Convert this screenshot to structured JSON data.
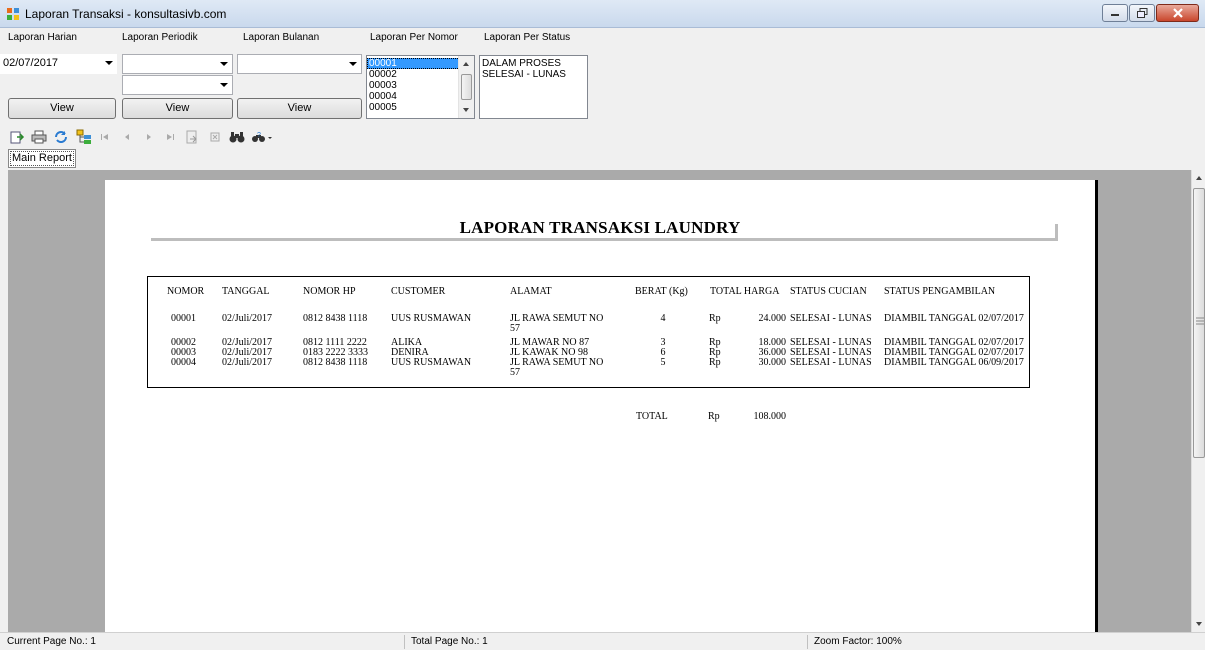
{
  "window": {
    "title": "Laporan Transaksi - konsultasivb.com"
  },
  "filters": {
    "harian": {
      "label": "Laporan Harian",
      "value": "02/07/2017",
      "button": "View"
    },
    "periodik": {
      "label": "Laporan Periodik",
      "value1": "",
      "value2": "",
      "button": "View"
    },
    "bulanan": {
      "label": "Laporan Bulanan",
      "value": "",
      "button": "View"
    },
    "nomor": {
      "label": "Laporan Per Nomor",
      "items": [
        "00001",
        "00002",
        "00003",
        "00004",
        "00005"
      ],
      "selected": "00001"
    },
    "status": {
      "label": "Laporan Per Status",
      "items": [
        "DALAM PROSES",
        "SELESAI - LUNAS"
      ]
    }
  },
  "tabs": {
    "main": "Main Report"
  },
  "report": {
    "title": "LAPORAN TRANSAKSI LAUNDRY",
    "headers": [
      "NOMOR",
      "TANGGAL",
      "NOMOR HP",
      "CUSTOMER",
      "ALAMAT",
      "BERAT (Kg)",
      "TOTAL HARGA",
      "STATUS CUCIAN",
      "STATUS PENGAMBILAN"
    ],
    "rows": [
      {
        "nomor": "00001",
        "tanggal": "02/Juli/2017",
        "hp": "0812 8438 1118",
        "customer": "UUS RUSMAWAN",
        "alamat1": "JL RAWA SEMUT NO",
        "alamat2": "57",
        "berat": "4",
        "rp": "Rp",
        "harga": "24.000",
        "status": "SELESAI - LUNAS",
        "ambil": "DIAMBIL TANGGAL 02/07/2017"
      },
      {
        "nomor": "00002",
        "tanggal": "02/Juli/2017",
        "hp": "0812 1111 2222",
        "customer": "ALIKA",
        "alamat1": "JL MAWAR NO 87",
        "alamat2": "",
        "berat": "3",
        "rp": "Rp",
        "harga": "18.000",
        "status": "SELESAI - LUNAS",
        "ambil": "DIAMBIL TANGGAL 02/07/2017"
      },
      {
        "nomor": "00003",
        "tanggal": "02/Juli/2017",
        "hp": "0183 2222 3333",
        "customer": "DENIRA",
        "alamat1": "JL KAWAK NO 98",
        "alamat2": "",
        "berat": "6",
        "rp": "Rp",
        "harga": "36.000",
        "status": "SELESAI - LUNAS",
        "ambil": "DIAMBIL TANGGAL 02/07/2017"
      },
      {
        "nomor": "00004",
        "tanggal": "02/Juli/2017",
        "hp": "0812 8438 1118",
        "customer": "UUS RUSMAWAN",
        "alamat1": "JL RAWA SEMUT NO",
        "alamat2": "57",
        "berat": "5",
        "rp": "Rp",
        "harga": "30.000",
        "status": "SELESAI - LUNAS",
        "ambil": "DIAMBIL TANGGAL 06/09/2017"
      }
    ],
    "total": {
      "label": "TOTAL",
      "rp": "Rp",
      "value": "108.000"
    }
  },
  "statusbar": {
    "current_page": "Current Page No.: 1",
    "total_page": "Total Page No.: 1",
    "zoom": "Zoom Factor: 100%"
  }
}
